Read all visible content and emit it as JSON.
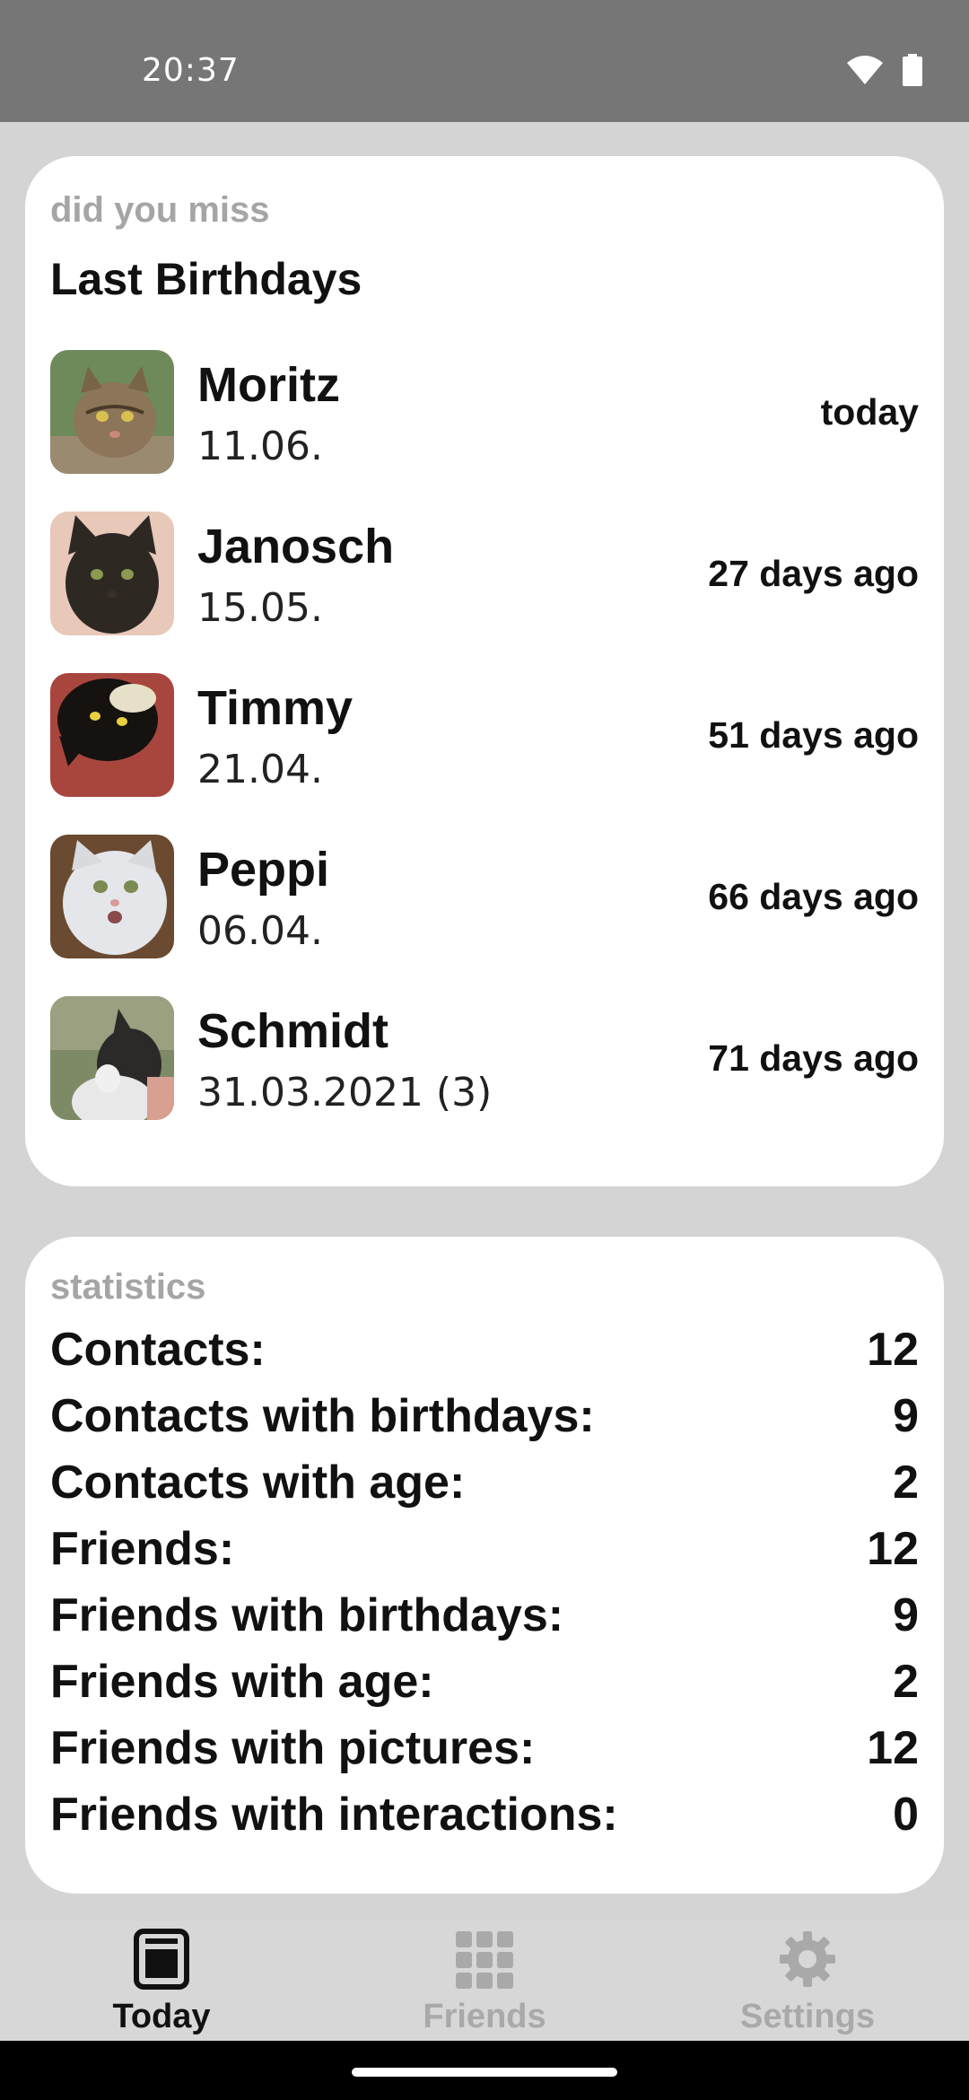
{
  "status_bar": {
    "time": "20:37",
    "icons": [
      "wifi-icon",
      "battery-icon"
    ]
  },
  "last_birthdays": {
    "overline": "did you miss",
    "title": "Last Birthdays",
    "items": [
      {
        "name": "Moritz",
        "date": "11.06.",
        "ago": "today"
      },
      {
        "name": "Janosch",
        "date": "15.05.",
        "ago": "27 days ago"
      },
      {
        "name": "Timmy",
        "date": "21.04.",
        "ago": "51 days ago"
      },
      {
        "name": "Peppi",
        "date": "06.04.",
        "ago": "66 days ago"
      },
      {
        "name": "Schmidt",
        "date": "31.03.2021 (3)",
        "ago": "71 days ago"
      }
    ]
  },
  "statistics": {
    "overline": "statistics",
    "rows": [
      {
        "label": "Contacts:",
        "value": "12"
      },
      {
        "label": "Contacts with birthdays:",
        "value": "9"
      },
      {
        "label": "Contacts with age:",
        "value": "2"
      },
      {
        "label": "Friends:",
        "value": "12"
      },
      {
        "label": "Friends with birthdays:",
        "value": "9"
      },
      {
        "label": "Friends with age:",
        "value": "2"
      },
      {
        "label": "Friends with pictures:",
        "value": "12"
      },
      {
        "label": "Friends with interactions:",
        "value": "0"
      }
    ]
  },
  "bottom_nav": {
    "items": [
      {
        "label": "Today",
        "icon": "today-icon",
        "active": true
      },
      {
        "label": "Friends",
        "icon": "grid-icon",
        "active": false
      },
      {
        "label": "Settings",
        "icon": "gear-icon",
        "active": false
      }
    ]
  },
  "colors": {
    "background": "#d4d4d4",
    "card": "#ffffff",
    "status_bar": "#767676",
    "muted_text": "#a5a5a5",
    "nav_inactive": "#a9a9a9"
  }
}
